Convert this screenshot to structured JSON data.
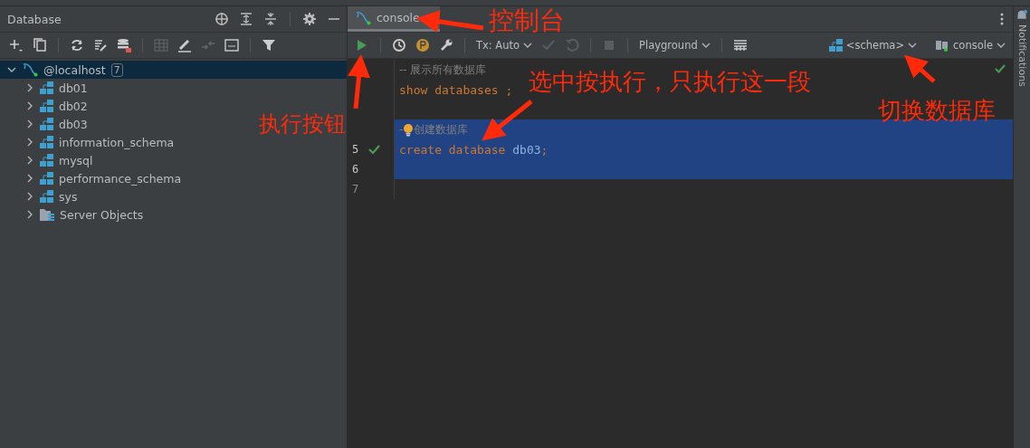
{
  "database_panel": {
    "title": "Database",
    "tree": [
      {
        "label": "@localhost",
        "count": "7",
        "kind": "host",
        "expanded": true,
        "selected": true,
        "children": [
          {
            "label": "db01",
            "kind": "schema",
            "expanded": false,
            "selected": false
          },
          {
            "label": "db02",
            "kind": "schema",
            "expanded": false,
            "selected": false
          },
          {
            "label": "db03",
            "kind": "schema",
            "expanded": false,
            "selected": false
          },
          {
            "label": "information_schema",
            "kind": "schema",
            "expanded": false,
            "selected": false
          },
          {
            "label": "mysql",
            "kind": "schema",
            "expanded": false,
            "selected": false
          },
          {
            "label": "performance_schema",
            "kind": "schema",
            "expanded": false,
            "selected": false
          },
          {
            "label": "sys",
            "kind": "schema",
            "expanded": false,
            "selected": false
          },
          {
            "label": "Server Objects",
            "kind": "folder",
            "expanded": false,
            "selected": false
          }
        ]
      }
    ]
  },
  "editor": {
    "tabs": [
      {
        "label": "console",
        "selected": true
      }
    ],
    "toolbar": {
      "tx_mode": "Tx: Auto",
      "mode": "Playground",
      "schema": "<schema>",
      "session": "console"
    },
    "lines": [
      {
        "selected": false,
        "executed": false,
        "segments": [
          {
            "kind": "comment",
            "text": "-- 展示所有数据库"
          }
        ]
      },
      {
        "selected": false,
        "executed": false,
        "segments": [
          {
            "kind": "keyword",
            "text": "show databases ;"
          }
        ]
      },
      {
        "selected": false,
        "executed": false
      },
      {
        "selected": true,
        "executed": false,
        "segments": [
          {
            "kind": "comment",
            "text": "-"
          },
          {
            "kind": "bulb"
          },
          {
            "kind": "comment",
            "text": "创建数据库"
          }
        ]
      },
      {
        "number": "5",
        "selected": true,
        "executed": true,
        "segments": [
          {
            "kind": "keyword",
            "text": "create database "
          },
          {
            "kind": "identifier",
            "text": "db03"
          },
          {
            "kind": "keyword",
            "text": ";"
          }
        ]
      },
      {
        "number": "6",
        "selected": true,
        "executed": false
      },
      {
        "number": "7",
        "selected": false,
        "executed": false
      }
    ]
  },
  "notifications_label": "Notifications",
  "annotations": [
    {
      "text": "控制台"
    },
    {
      "text": "执行按钮"
    },
    {
      "text": "选中按执行，只执行这一段"
    },
    {
      "text": "切换数据库"
    }
  ]
}
